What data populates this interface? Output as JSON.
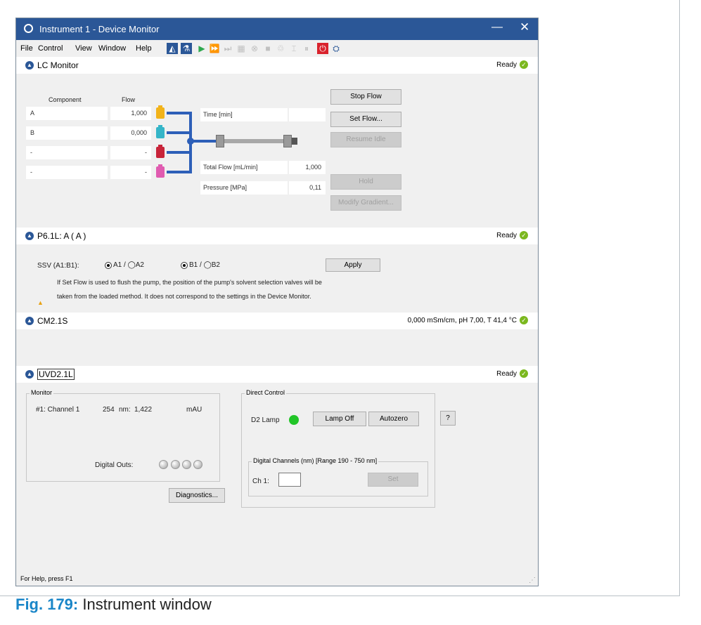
{
  "window": {
    "title": "Instrument 1 - Device Monitor",
    "minimize": "—",
    "close": "✕"
  },
  "menu": {
    "file": "File",
    "control": "Control",
    "view": "View",
    "window": "Window",
    "help": "Help"
  },
  "lc_monitor": {
    "title": "LC Monitor",
    "status": "Ready",
    "component_header": "Component",
    "flow_header": "Flow",
    "rows": [
      {
        "component": "A",
        "flow": "1,000"
      },
      {
        "component": "B",
        "flow": "0,000"
      },
      {
        "component": "-",
        "flow": "-"
      },
      {
        "component": "-",
        "flow": "-"
      }
    ],
    "time_label": "Time [min]",
    "time_value": "",
    "total_flow_label": "Total Flow [mL/min]",
    "total_flow_value": "1,000",
    "pressure_label": "Pressure [MPa]",
    "pressure_value": "0,11",
    "buttons": {
      "stop_flow": "Stop Flow",
      "set_flow": "Set Flow...",
      "resume_idle": "Resume Idle",
      "hold": "Hold",
      "modify_gradient": "Modify Gradient..."
    },
    "bottle_colors": [
      "#f2b31a",
      "#35b5c8",
      "#c8243a",
      "#e05bb0"
    ]
  },
  "pump": {
    "title": "P6.1L: A ( A )",
    "status": "Ready",
    "ssv_label": "SSV (A1:B1):",
    "a_option": "A1 / ◯A2",
    "b_option": "B1 / ◯B2",
    "apply": "Apply",
    "note_line1": "If Set Flow is used to flush the pump, the position of the pump's solvent selection valves will be",
    "note_line2": "taken from the loaded method. It does not correspond to the settings in the Device Monitor."
  },
  "cm": {
    "title": "CM2.1S",
    "status": "0,000 mSm/cm, pH 7,00, T 41,4 °C"
  },
  "uvd": {
    "title": "UVD2.1L",
    "status": "Ready",
    "monitor_label": "Monitor",
    "channel_name": "#1: Channel 1",
    "wavelength": "254",
    "wavelength_unit": "nm:",
    "absorbance": "1,422",
    "absorbance_unit": "mAU",
    "digital_outs_label": "Digital Outs:",
    "diagnostics": "Diagnostics...",
    "direct_control_label": "Direct Control",
    "d2_lamp_label": "D2 Lamp",
    "lamp_off": "Lamp Off",
    "autozero": "Autozero",
    "help": "?",
    "digital_channels_label": "Digital Channels (nm) [Range 190 - 750 nm]",
    "ch1_label": "Ch 1:",
    "ch1_value": "",
    "set": "Set"
  },
  "statusbar": {
    "text": "For Help, press F1"
  },
  "caption": {
    "fig": "Fig. 179:",
    "text": "Instrument window"
  }
}
